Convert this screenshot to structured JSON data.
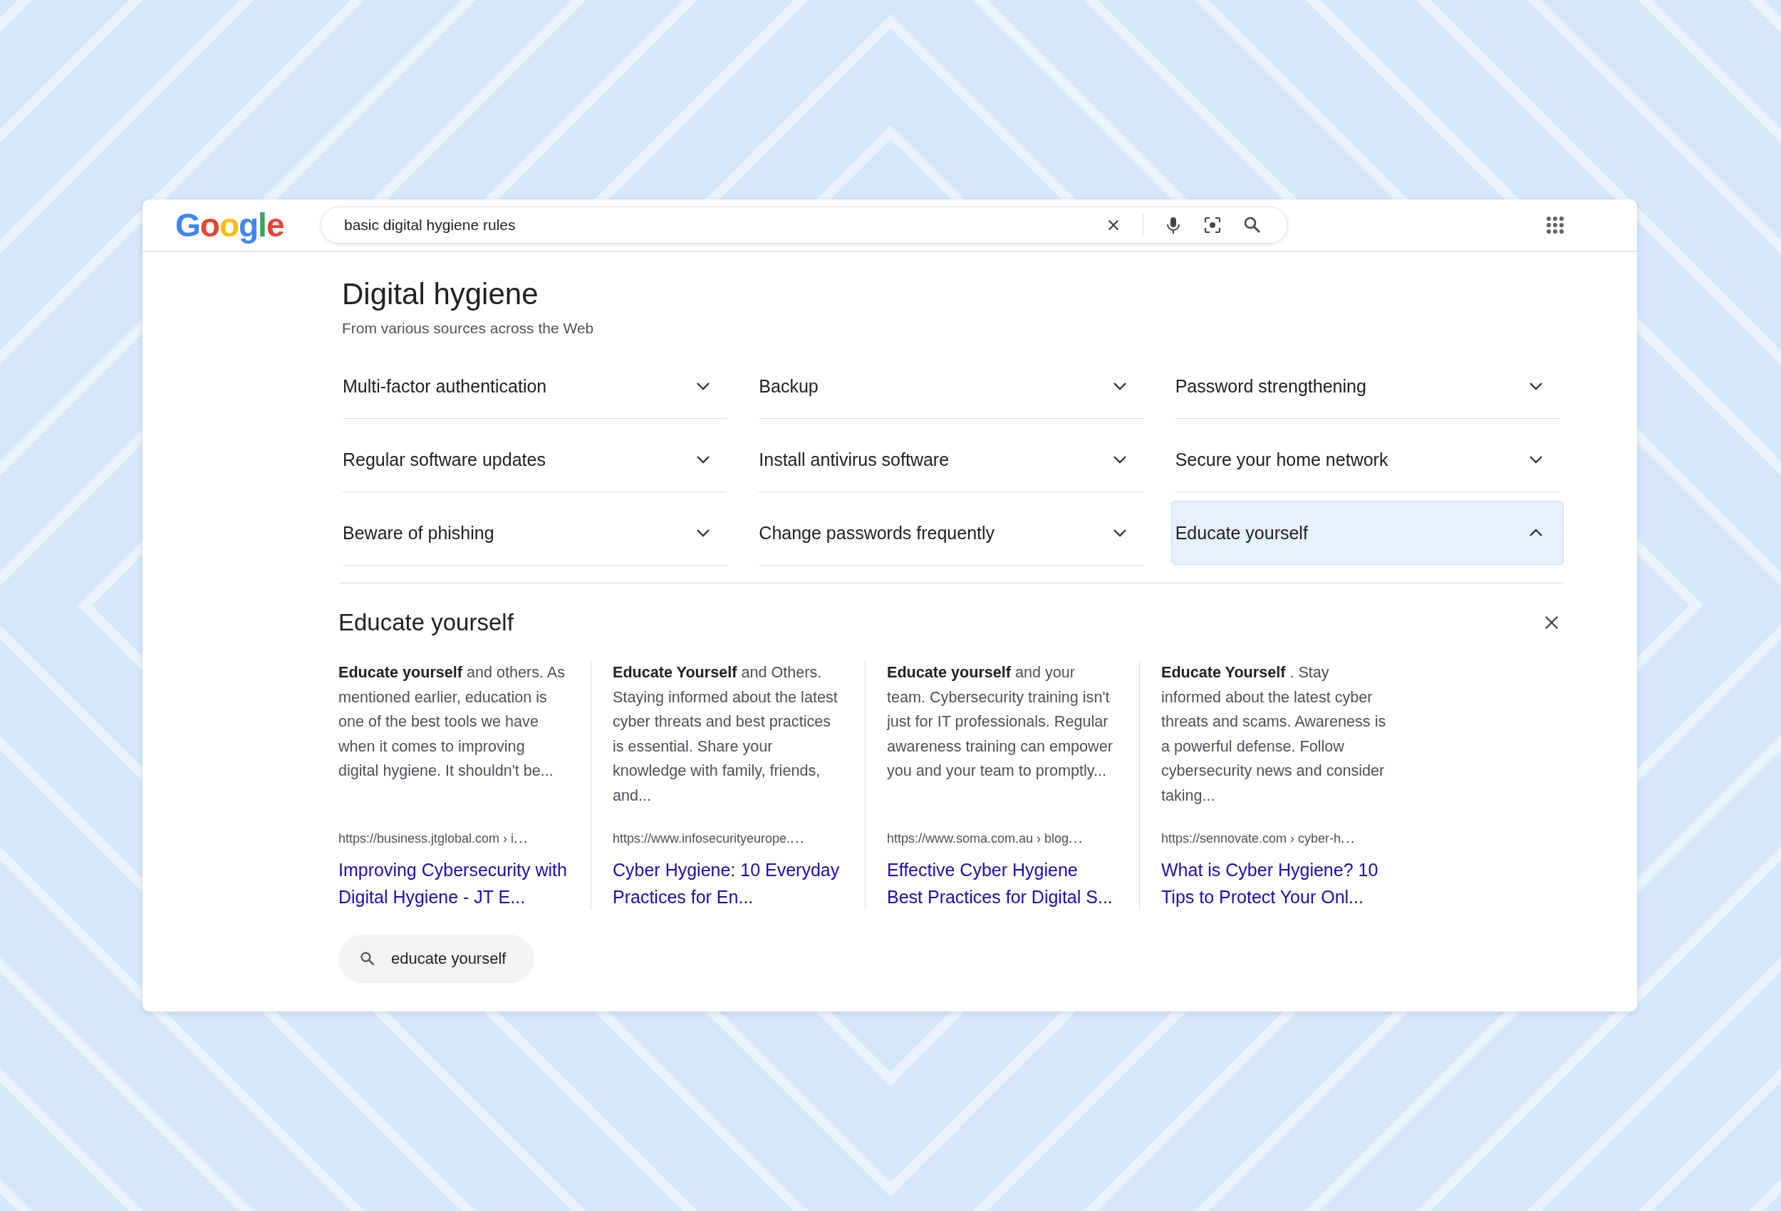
{
  "header": {
    "logo": "Google",
    "search": {
      "value": "basic digital hygiene rules"
    }
  },
  "panel": {
    "title": "Digital hygiene",
    "subtitle": "From various sources across the Web",
    "topics": [
      {
        "label": "Multi-factor authentication",
        "expanded": false
      },
      {
        "label": "Backup",
        "expanded": false
      },
      {
        "label": "Password strengthening",
        "expanded": false
      },
      {
        "label": "Regular software updates",
        "expanded": false
      },
      {
        "label": "Install antivirus software",
        "expanded": false
      },
      {
        "label": "Secure your home network",
        "expanded": false
      },
      {
        "label": "Beware of phishing",
        "expanded": false
      },
      {
        "label": "Change passwords frequently",
        "expanded": false
      },
      {
        "label": "Educate yourself",
        "expanded": true
      }
    ]
  },
  "detail": {
    "title": "Educate yourself",
    "results": [
      {
        "snippet": "**Educate yourself** and others. As mentioned earlier, education is one of the best tools we have when it comes to improving digital hygiene. It shouldn't be...",
        "url": "https://business.jtglobal.com › i",
        "url_more": "...",
        "link": "Improving Cybersecurity with Digital Hygiene - JT E..."
      },
      {
        "snippet": "**Educate Yourself** and Others. Staying informed about the latest cyber threats and best practices is essential. Share your knowledge with family, friends, and...",
        "url": "https://www.infosecurityeurope.",
        "url_more": "...",
        "link": "Cyber Hygiene: 10 Everyday Practices for En..."
      },
      {
        "snippet": "**Educate yourself** and your team. Cybersecurity training isn't just for IT professionals. Regular awareness training can empower you and your team to promptly...",
        "url": "https://www.soma.com.au › blog",
        "url_more": "...",
        "link": "Effective Cyber Hygiene Best Practices for Digital S..."
      },
      {
        "snippet": "**Educate Yourself** . Stay informed about the latest cyber threats and scams. Awareness is a powerful defense. Follow cybersecurity news and consider taking...",
        "url": "https://sennovate.com › cyber-h",
        "url_more": "...",
        "link": "What is Cyber Hygiene? 10 Tips to Protect Your Onl..."
      }
    ],
    "chip": "educate yourself"
  }
}
